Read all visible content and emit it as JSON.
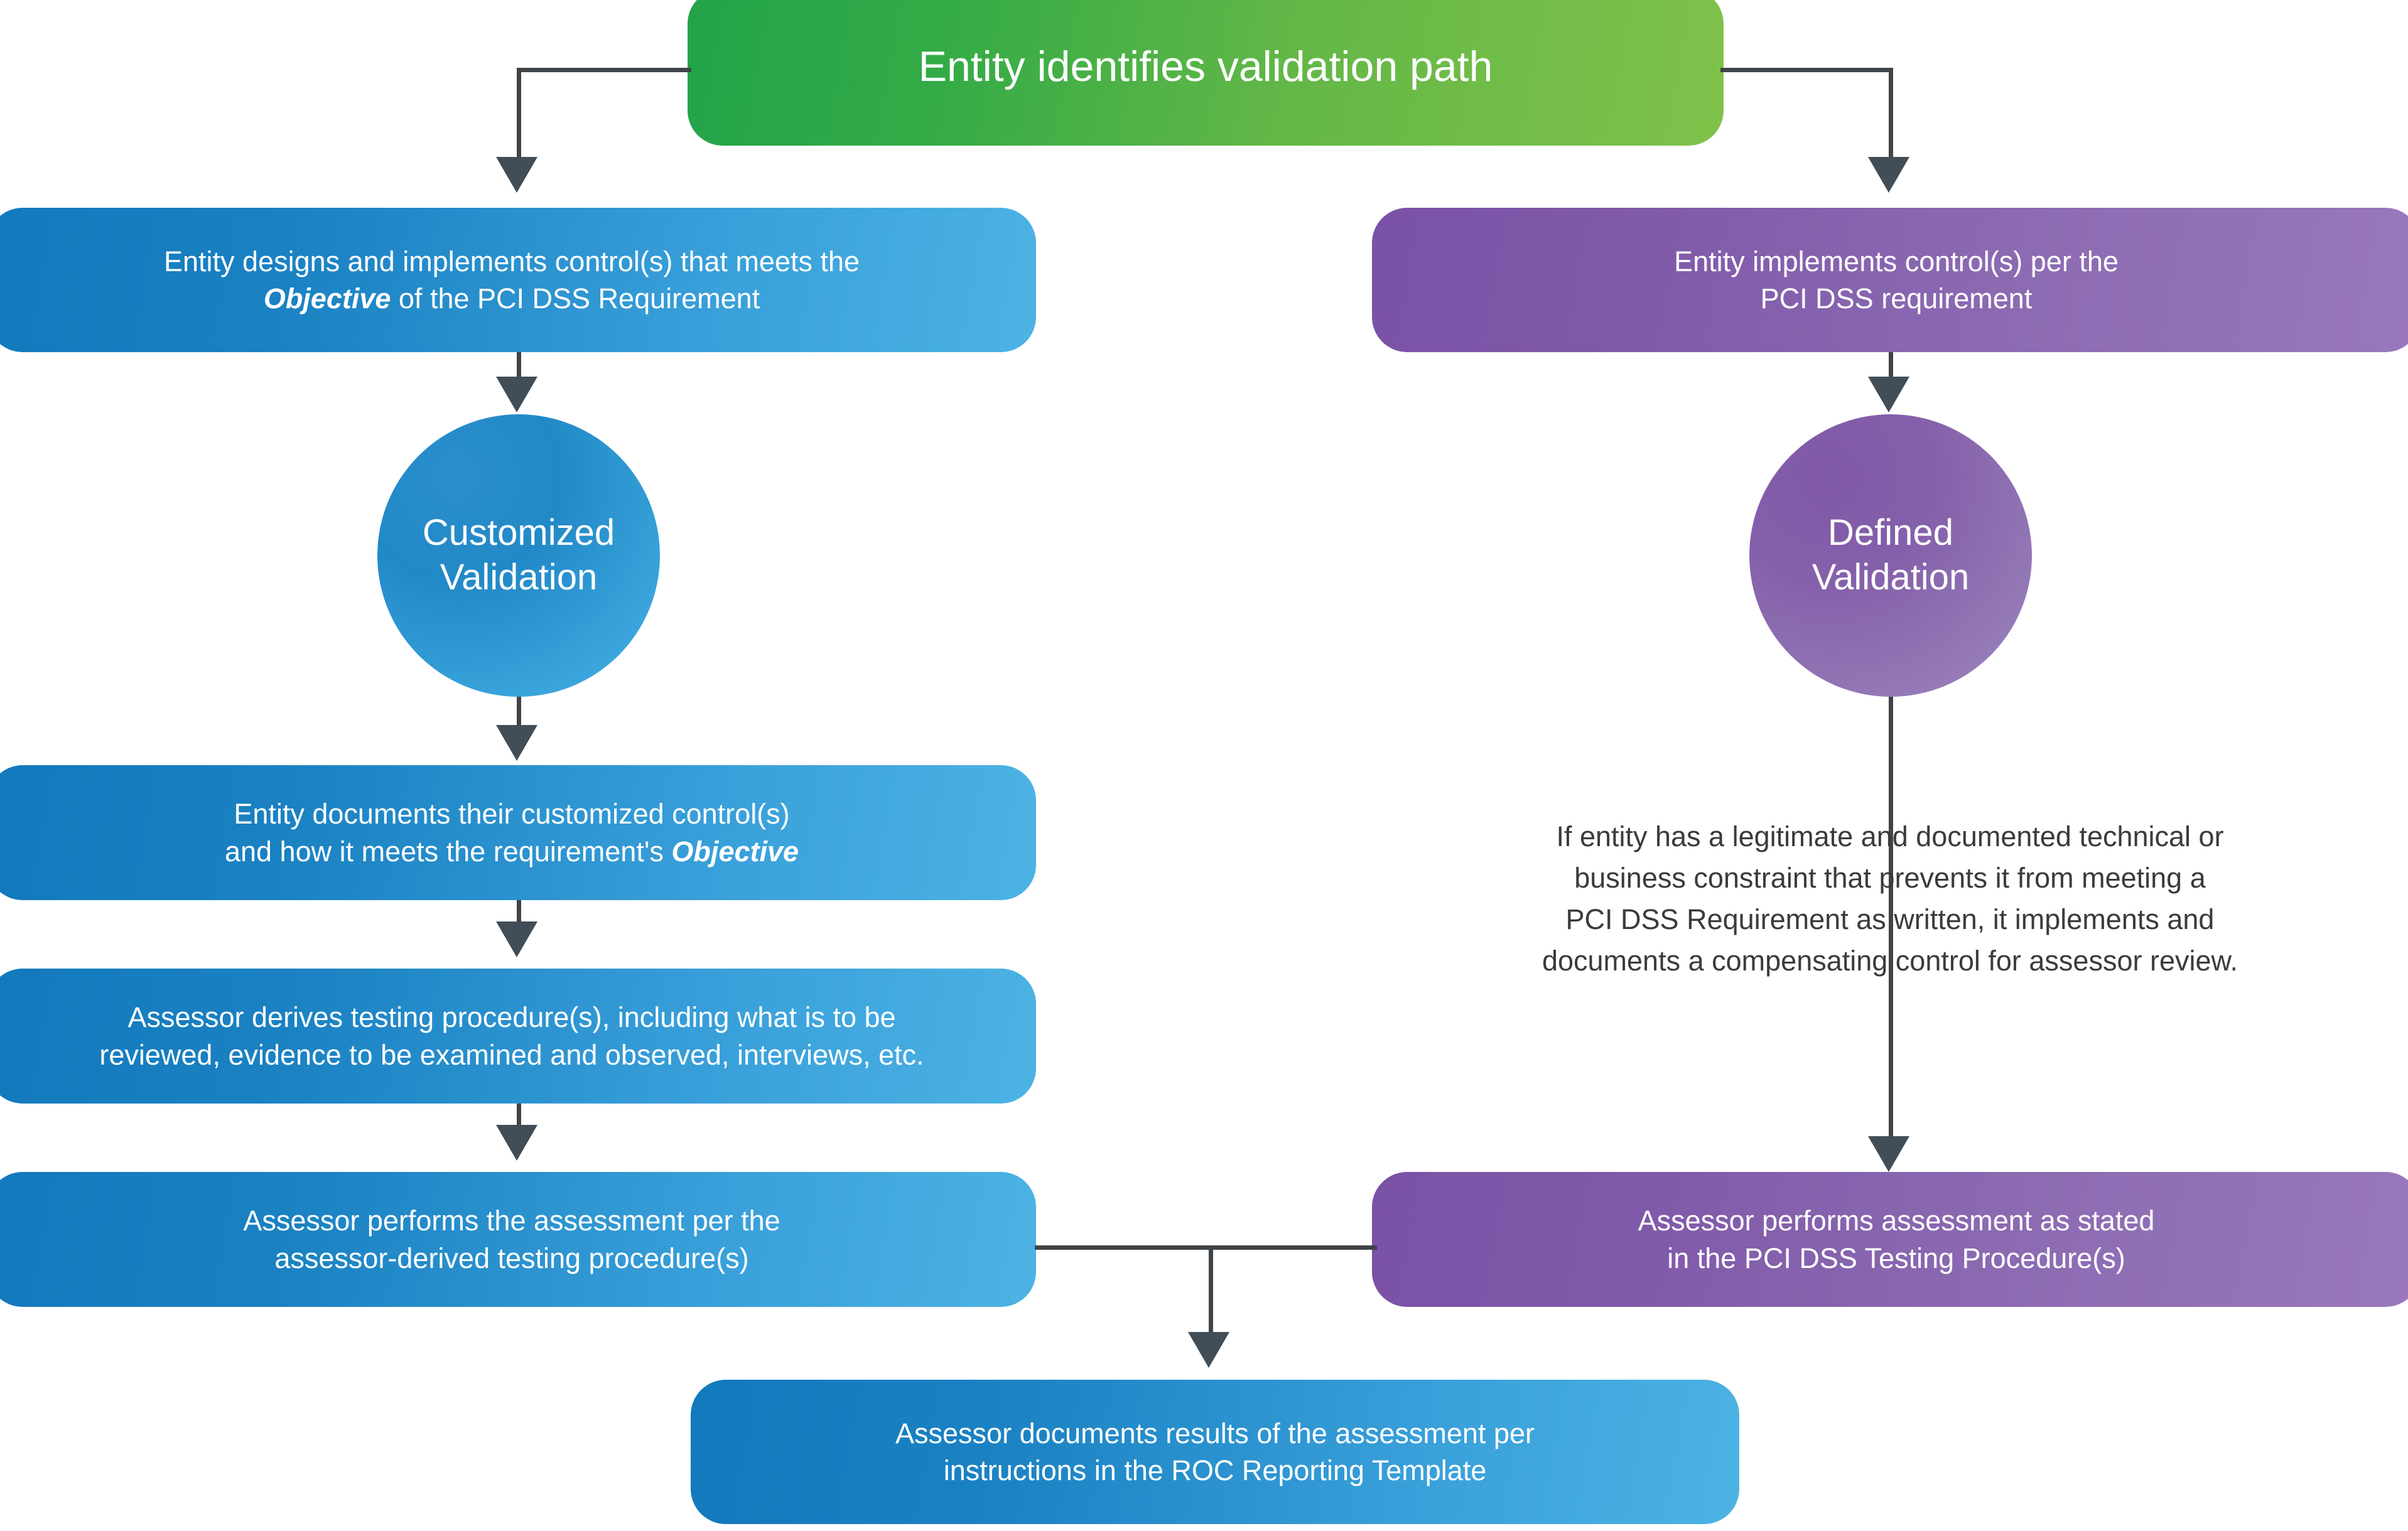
{
  "diagram": {
    "title_node": {
      "label": "Entity identifies validation path",
      "color": "#34ab46"
    },
    "left_path": {
      "step1": {
        "line1": "Entity designs and implements control(s) that meets the",
        "line2_pre": "",
        "line2_em": "Objective",
        "line2_post": " of the PCI DSS Requirement",
        "color": "#1a81c2"
      },
      "circle": {
        "line1": "Customized",
        "line2": "Validation",
        "color": "#2289c7"
      },
      "step2": {
        "line1": "Entity documents their customized control(s)",
        "line2_pre": "and how it meets the requirement's ",
        "line2_em": "Objective",
        "line2_post": "",
        "color": "#1a81c2"
      },
      "step3": {
        "line1": "Assessor derives testing procedure(s), including what is to be",
        "line2": "reviewed, evidence to be examined and observed, interviews, etc.",
        "color": "#1a81c2"
      },
      "step4": {
        "line1": "Assessor performs the assessment per the",
        "line2": "assessor-derived testing procedure(s)",
        "color": "#1a81c2"
      }
    },
    "right_path": {
      "step1": {
        "line1": "Entity implements control(s) per the",
        "line2": "PCI DSS requirement",
        "color": "#8460aa"
      },
      "circle": {
        "line1": "Defined",
        "line2": "Validation",
        "color": "#8460aa"
      },
      "note": {
        "line1": "If entity has a legitimate and documented technical or",
        "line2": "business constraint that prevents it from meeting a",
        "line3": "PCI DSS Requirement as written, it implements and",
        "line4": "documents a compensating control for assessor review.",
        "color": "#3b3b3b"
      },
      "step2": {
        "line1": "Assessor performs assessment as stated",
        "line2": "in the PCI DSS Testing Procedure(s)",
        "color": "#8460aa"
      }
    },
    "final_node": {
      "line1": "Assessor documents results of the assessment per",
      "line2": "instructions in the ROC Reporting Template",
      "color": "#1a81c2"
    },
    "connector_color": "#3f4448",
    "arrow_color": "#414d57"
  }
}
